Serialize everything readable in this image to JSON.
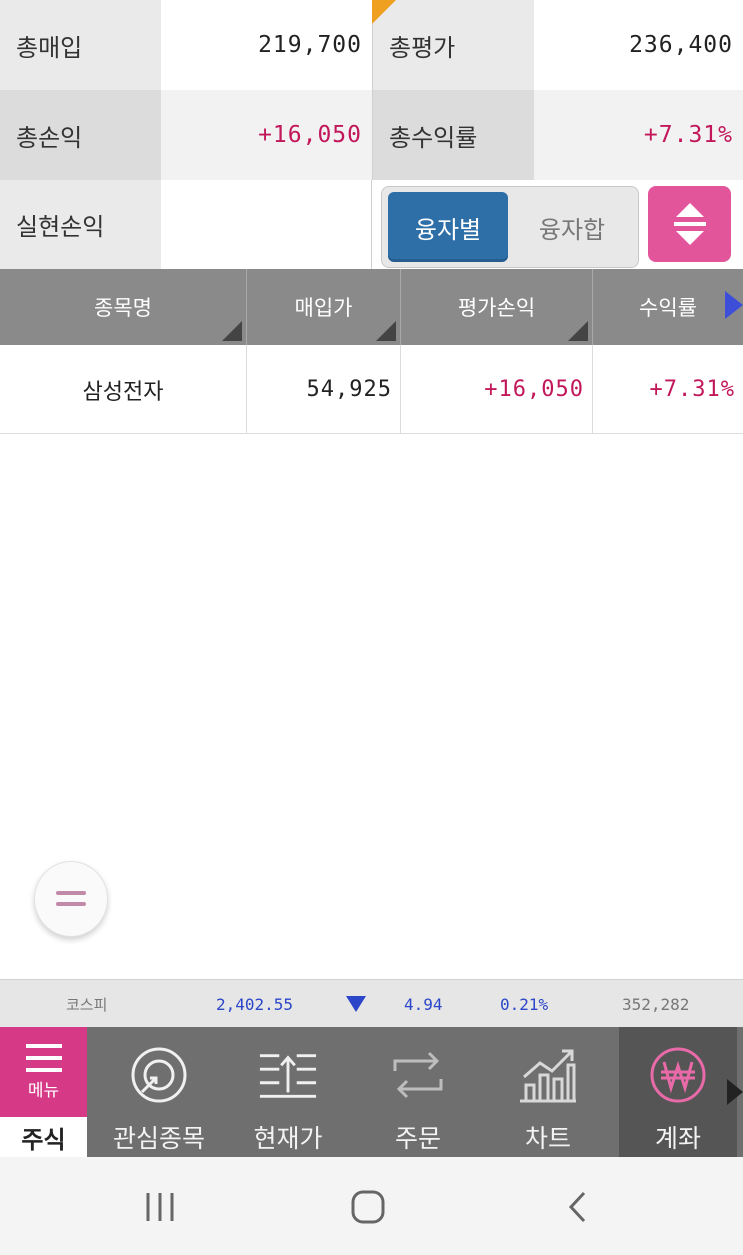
{
  "summary": {
    "total_purchase_label": "총매입",
    "total_purchase_value": "219,700",
    "total_evaluation_label": "총평가",
    "total_evaluation_value": "236,400",
    "total_pnl_label": "총손익",
    "total_pnl_value": "+16,050",
    "total_return_label": "총수익률",
    "total_return_value": "+7.31%",
    "realized_pnl_label": "실현손익",
    "realized_pnl_value": ""
  },
  "toggle": {
    "by_loan_label": "융자별",
    "loan_sum_label": "융자합",
    "selected": "융자별"
  },
  "table": {
    "headers": [
      "종목명",
      "매입가",
      "평가손익",
      "수익률"
    ],
    "rows": [
      {
        "name": "삼성전자",
        "purchase_price": "54,925",
        "pnl": "+16,050",
        "return": "+7.31%"
      }
    ]
  },
  "ticker": {
    "index_name": "코스피",
    "index_value": "2,402.55",
    "change": "4.94",
    "change_pct": "0.21%",
    "volume": "352,282"
  },
  "app_nav": {
    "menu_label": "메뉴",
    "stock_label": "주식",
    "items": [
      {
        "label": "관심종목",
        "icon": "watchlist-icon"
      },
      {
        "label": "현재가",
        "icon": "current-price-icon"
      },
      {
        "label": "주문",
        "icon": "order-icon"
      },
      {
        "label": "차트",
        "icon": "chart-icon"
      },
      {
        "label": "계좌",
        "icon": "won-icon",
        "active": true
      }
    ]
  },
  "colors": {
    "positive": "#c2185b",
    "negative": "#2b46c9",
    "accent_pink": "#d63a86",
    "toggle_blue": "#2f6fa8",
    "header_grey": "#8a8a8a"
  }
}
